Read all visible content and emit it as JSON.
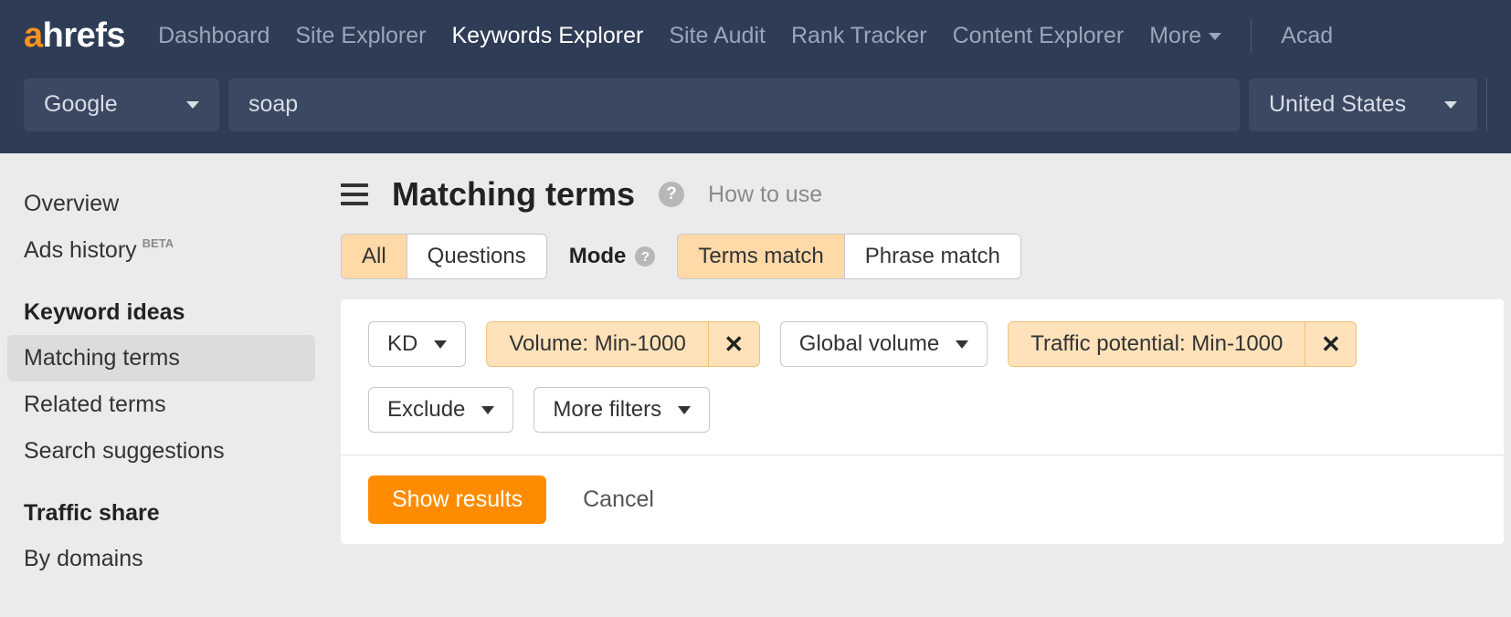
{
  "logo": {
    "first": "a",
    "rest": "hrefs"
  },
  "nav": {
    "items": [
      {
        "label": "Dashboard"
      },
      {
        "label": "Site Explorer"
      },
      {
        "label": "Keywords Explorer",
        "active": true
      },
      {
        "label": "Site Audit"
      },
      {
        "label": "Rank Tracker"
      },
      {
        "label": "Content Explorer"
      }
    ],
    "more": "More",
    "academy": "Acad"
  },
  "search": {
    "engine": "Google",
    "query": "soap",
    "country": "United States"
  },
  "sidebar": {
    "links1": [
      {
        "label": "Overview"
      },
      {
        "label": "Ads history",
        "beta": "BETA"
      }
    ],
    "heading1": "Keyword ideas",
    "links2": [
      {
        "label": "Matching terms",
        "active": true
      },
      {
        "label": "Related terms"
      },
      {
        "label": "Search suggestions"
      }
    ],
    "heading2": "Traffic share",
    "links3": [
      {
        "label": "By domains"
      }
    ]
  },
  "main": {
    "title": "Matching terms",
    "how_to": "How to use",
    "seg1": {
      "all": "All",
      "questions": "Questions"
    },
    "mode_label": "Mode",
    "seg2": {
      "terms": "Terms match",
      "phrase": "Phrase match"
    },
    "filters": {
      "kd": "KD",
      "volume_chip": "Volume: Min-1000",
      "global_volume": "Global volume",
      "traffic_chip": "Traffic potential: Min-1000",
      "exclude": "Exclude",
      "more": "More filters"
    },
    "actions": {
      "show": "Show results",
      "cancel": "Cancel"
    }
  }
}
